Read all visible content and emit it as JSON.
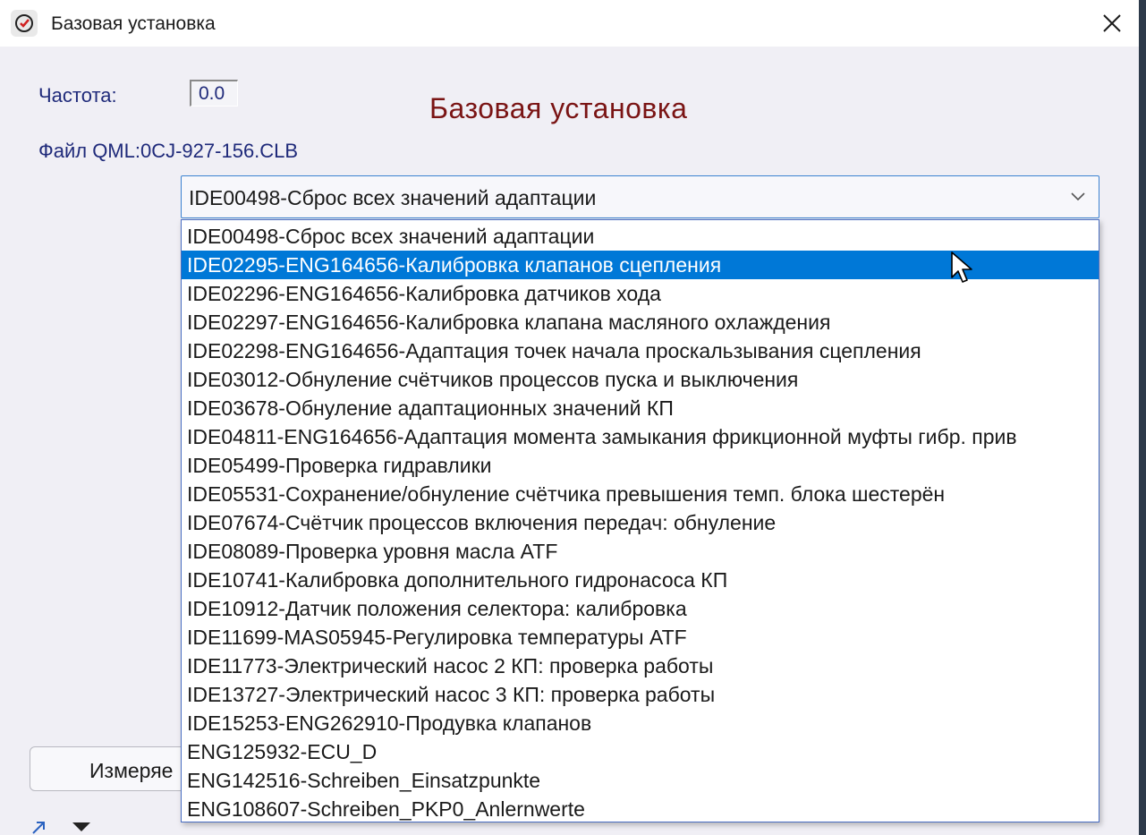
{
  "window": {
    "title": "Базовая установка"
  },
  "form": {
    "frequency_label": "Частота:",
    "frequency_value": "0.0",
    "heading": "Базовая установка",
    "file_label": "Файл QML:0CJ-927-156.CLB"
  },
  "select": {
    "selected_value": "IDE00498-Сброс всех значений адаптации"
  },
  "dropdown": {
    "highlighted_index": 1,
    "options": [
      "IDE00498-Сброс всех значений адаптации",
      "IDE02295-ENG164656-Калибровка клапанов сцепления",
      "IDE02296-ENG164656-Калибровка датчиков хода",
      "IDE02297-ENG164656-Калибровка клапана масляного охлаждения",
      "IDE02298-ENG164656-Адаптация точек начала проскальзывания сцепления",
      "IDE03012-Обнуление счётчиков процессов пуска и выключения",
      "IDE03678-Обнуление адаптационных значений КП",
      "IDE04811-ENG164656-Адаптация момента замыкания фрикционной муфты гибр. прив",
      "IDE05499-Проверка гидравлики",
      "IDE05531-Сохранение/обнуление счётчика превышения темп. блока шестерён",
      "IDE07674-Счётчик процессов включения передач: обнуление",
      "IDE08089-Проверка уровня масла ATF",
      "IDE10741-Калибровка дополнительного гидронасоса КП",
      "IDE10912-Датчик положения селектора: калибровка",
      "IDE11699-MAS05945-Регулировка температуры ATF",
      "IDE11773-Электрический насос 2 КП: проверка работы",
      "IDE13727-Электрический насос 3 КП: проверка работы",
      "IDE15253-ENG262910-Продувка клапанов",
      "ENG125932-ECU_D",
      "ENG142516-Schreiben_Einsatzpunkte",
      "ENG108607-Schreiben_PKP0_Anlernwerte"
    ]
  },
  "buttons": {
    "measure_label": "Измеряе"
  },
  "icons": {
    "app": "app-logo-icon",
    "close": "close-icon",
    "chevron": "chevron-down-icon",
    "cursor": "mouse-pointer-icon"
  },
  "colors": {
    "label_blue": "#1f2a7a",
    "heading_red": "#7a1414",
    "highlight": "#0078d7"
  }
}
